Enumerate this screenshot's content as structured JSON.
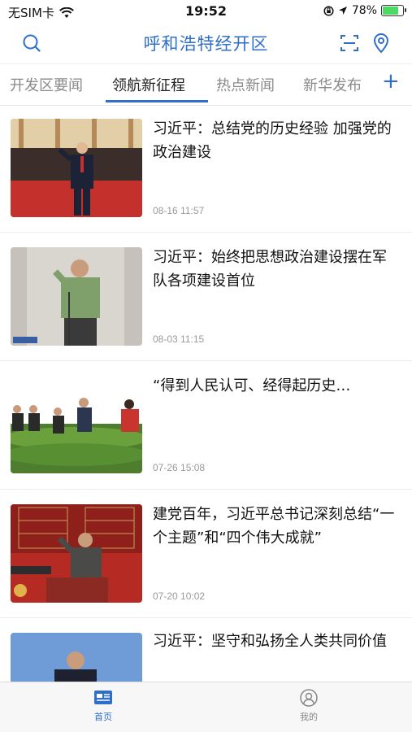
{
  "status_bar": {
    "carrier": "无SIM卡",
    "time": "19:52",
    "battery": "78%",
    "battery_level": 0.78
  },
  "header": {
    "title": "呼和浩特经开区",
    "accent_color": "#2f6fc9"
  },
  "tabs": [
    {
      "label": "开发区要闻",
      "active": false
    },
    {
      "label": "领航新征程",
      "active": true
    },
    {
      "label": "热点新闻",
      "active": false
    },
    {
      "label": "新华发布",
      "active": false
    }
  ],
  "tab_add_label": "+",
  "news": [
    {
      "title": "习近平：总结党的历史经验 加强党的政治建设",
      "time": "08-16 11:57"
    },
    {
      "title": "习近平：始终把思想政治建设摆在军队各项建设首位",
      "time": "08-03 11:15"
    },
    {
      "title": "“得到人民认可、经得起历史…",
      "time": "07-26 15:08"
    },
    {
      "title": "建党百年，习近平总书记深刻总结“一个主题”和“四个伟大成就”",
      "time": "07-20 10:02"
    },
    {
      "title": "习近平：坚守和弘扬全人类共同价值",
      "time": ""
    }
  ],
  "bottom_nav": [
    {
      "label": "首页",
      "active": true
    },
    {
      "label": "我的",
      "active": false
    }
  ]
}
